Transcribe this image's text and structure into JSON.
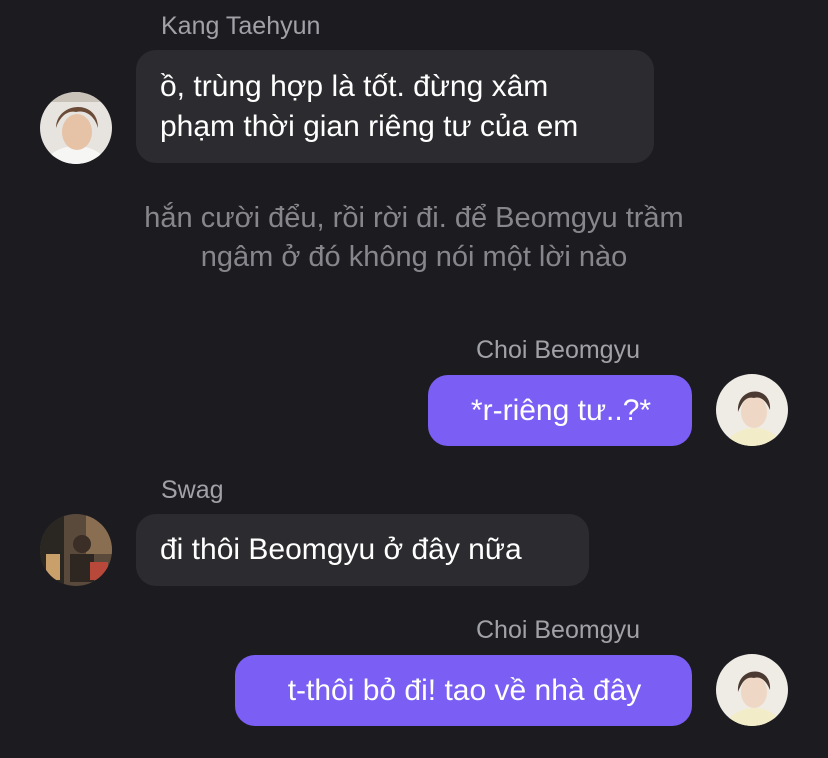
{
  "messages": [
    {
      "sender": "Kang Taehyun",
      "direction": "incoming",
      "avatar": "avatar-kang-taehyun",
      "lines": [
        "ồ, trùng hợp là tốt. đừng xâm",
        "phạm thời gian riêng tư của em"
      ]
    },
    {
      "type": "narration",
      "lines": [
        "hắn cười đểu, rồi rời đi. để Beomgyu trầm",
        "ngâm ở đó không nói một lời nào"
      ]
    },
    {
      "sender": "Choi Beomgyu",
      "direction": "outgoing",
      "avatar": "avatar-choi-beomgyu",
      "lines": [
        "*r-riêng tư..?*"
      ]
    },
    {
      "sender": "Swag",
      "direction": "incoming",
      "avatar": "avatar-swag",
      "lines": [
        "đi thôi Beomgyu ở đây nữa"
      ]
    },
    {
      "sender": "Choi Beomgyu",
      "direction": "outgoing",
      "avatar": "avatar-choi-beomgyu",
      "lines": [
        "t-thôi bỏ đi! tao về nhà đây"
      ]
    }
  ],
  "colors": {
    "background": "#1c1c20",
    "incoming_bubble": "#2c2c30",
    "outgoing_bubble": "#7b5ff5",
    "sender_name": "#a1a1a8",
    "narration": "#86868c"
  }
}
